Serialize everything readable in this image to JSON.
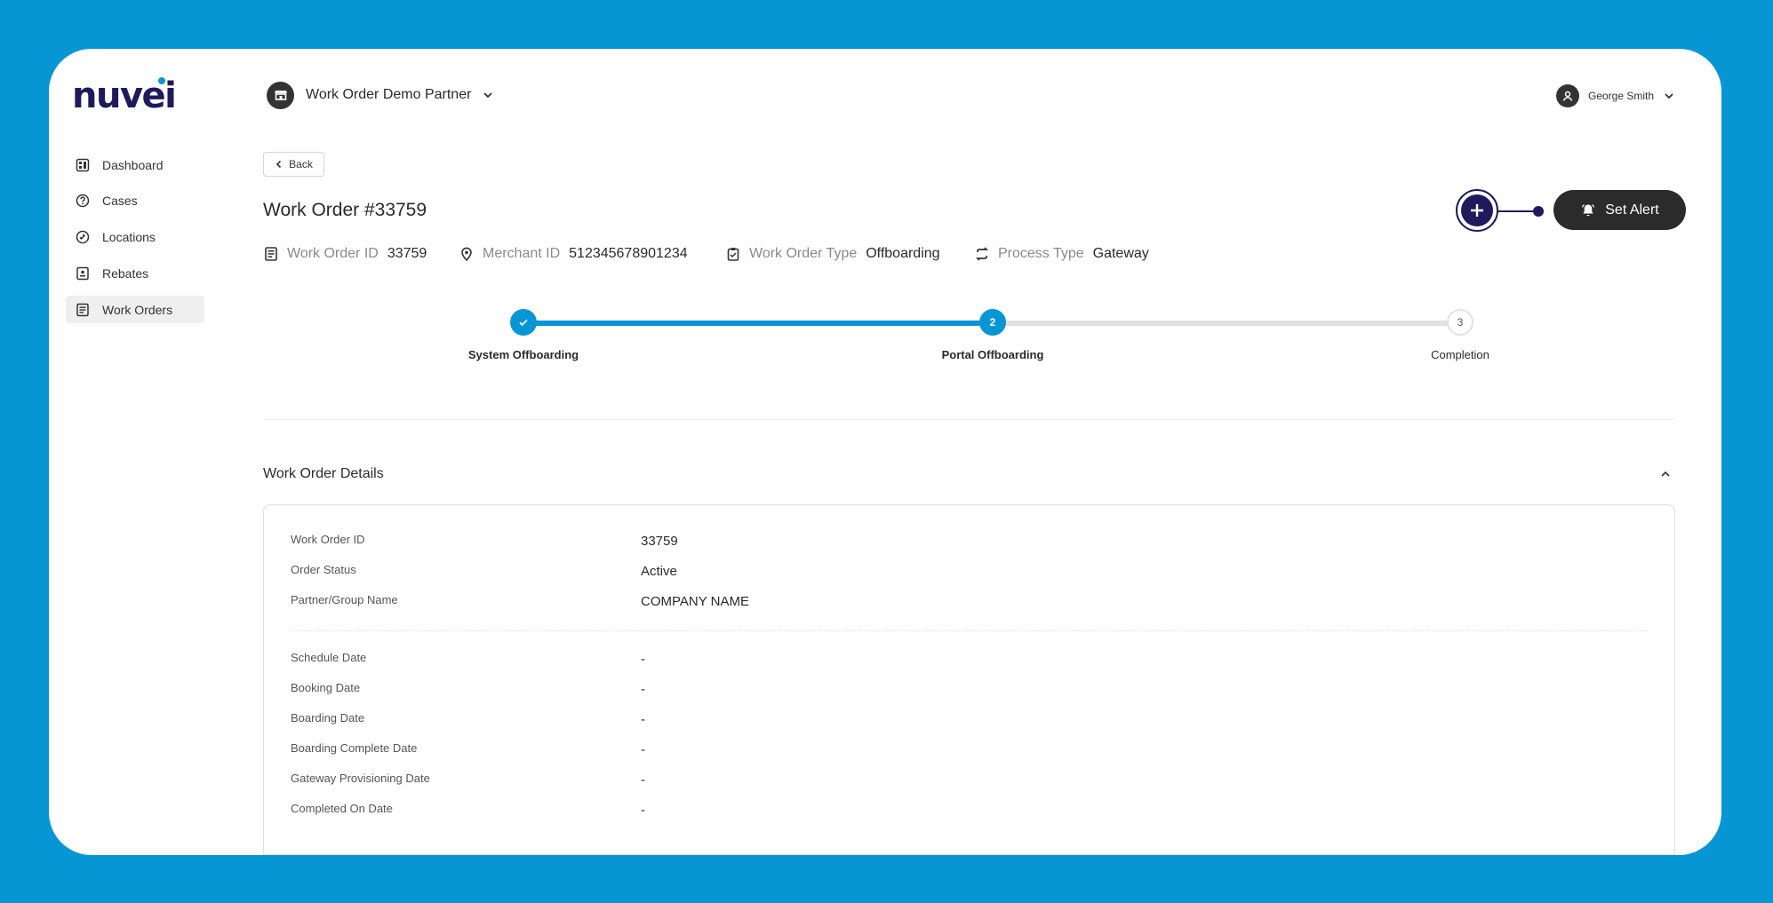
{
  "brand": {
    "logo_text": "nuvei"
  },
  "sidebar": {
    "items": [
      {
        "label": "Dashboard",
        "icon": "dashboard-icon"
      },
      {
        "label": "Cases",
        "icon": "help-circle-icon"
      },
      {
        "label": "Locations",
        "icon": "location-link-icon"
      },
      {
        "label": "Rebates",
        "icon": "rebate-icon"
      },
      {
        "label": "Work Orders",
        "icon": "document-icon",
        "active": true
      }
    ]
  },
  "header": {
    "partner_name": "Work Order Demo Partner",
    "user_name": "George Smith"
  },
  "page": {
    "back_label": "Back",
    "title": "Work Order #33759",
    "set_alert_label": "Set Alert"
  },
  "meta": {
    "work_order_id_label": "Work Order ID",
    "work_order_id": "33759",
    "merchant_id_label": "Merchant ID",
    "merchant_id": "512345678901234",
    "work_order_type_label": "Work Order Type",
    "work_order_type": "Offboarding",
    "process_type_label": "Process Type",
    "process_type": "Gateway"
  },
  "stepper": {
    "steps": [
      {
        "label": "System Offboarding",
        "number": "",
        "state": "done"
      },
      {
        "label": "Portal Offboarding",
        "number": "2",
        "state": "current"
      },
      {
        "label": "Completion",
        "number": "3",
        "state": "todo"
      }
    ],
    "progress": 0.5
  },
  "details": {
    "section_title": "Work Order Details",
    "rows": [
      {
        "label": "Work Order ID",
        "value": "33759"
      },
      {
        "label": "Order Status",
        "value": "Active"
      },
      {
        "label": "Partner/Group Name",
        "value": "COMPANY NAME"
      },
      {
        "label": "Schedule Date",
        "value": "-"
      },
      {
        "label": "Booking Date",
        "value": "-"
      },
      {
        "label": "Boarding Date",
        "value": "-"
      },
      {
        "label": "Boarding Complete Date",
        "value": "-"
      },
      {
        "label": "Gateway Provisioning Date",
        "value": "-"
      },
      {
        "label": "Completed On Date",
        "value": "-"
      }
    ]
  },
  "colors": {
    "background": "#0796d4",
    "accent": "#0796d4",
    "brand_navy": "#1f1a5c",
    "dark_button": "#2b2b2b"
  }
}
